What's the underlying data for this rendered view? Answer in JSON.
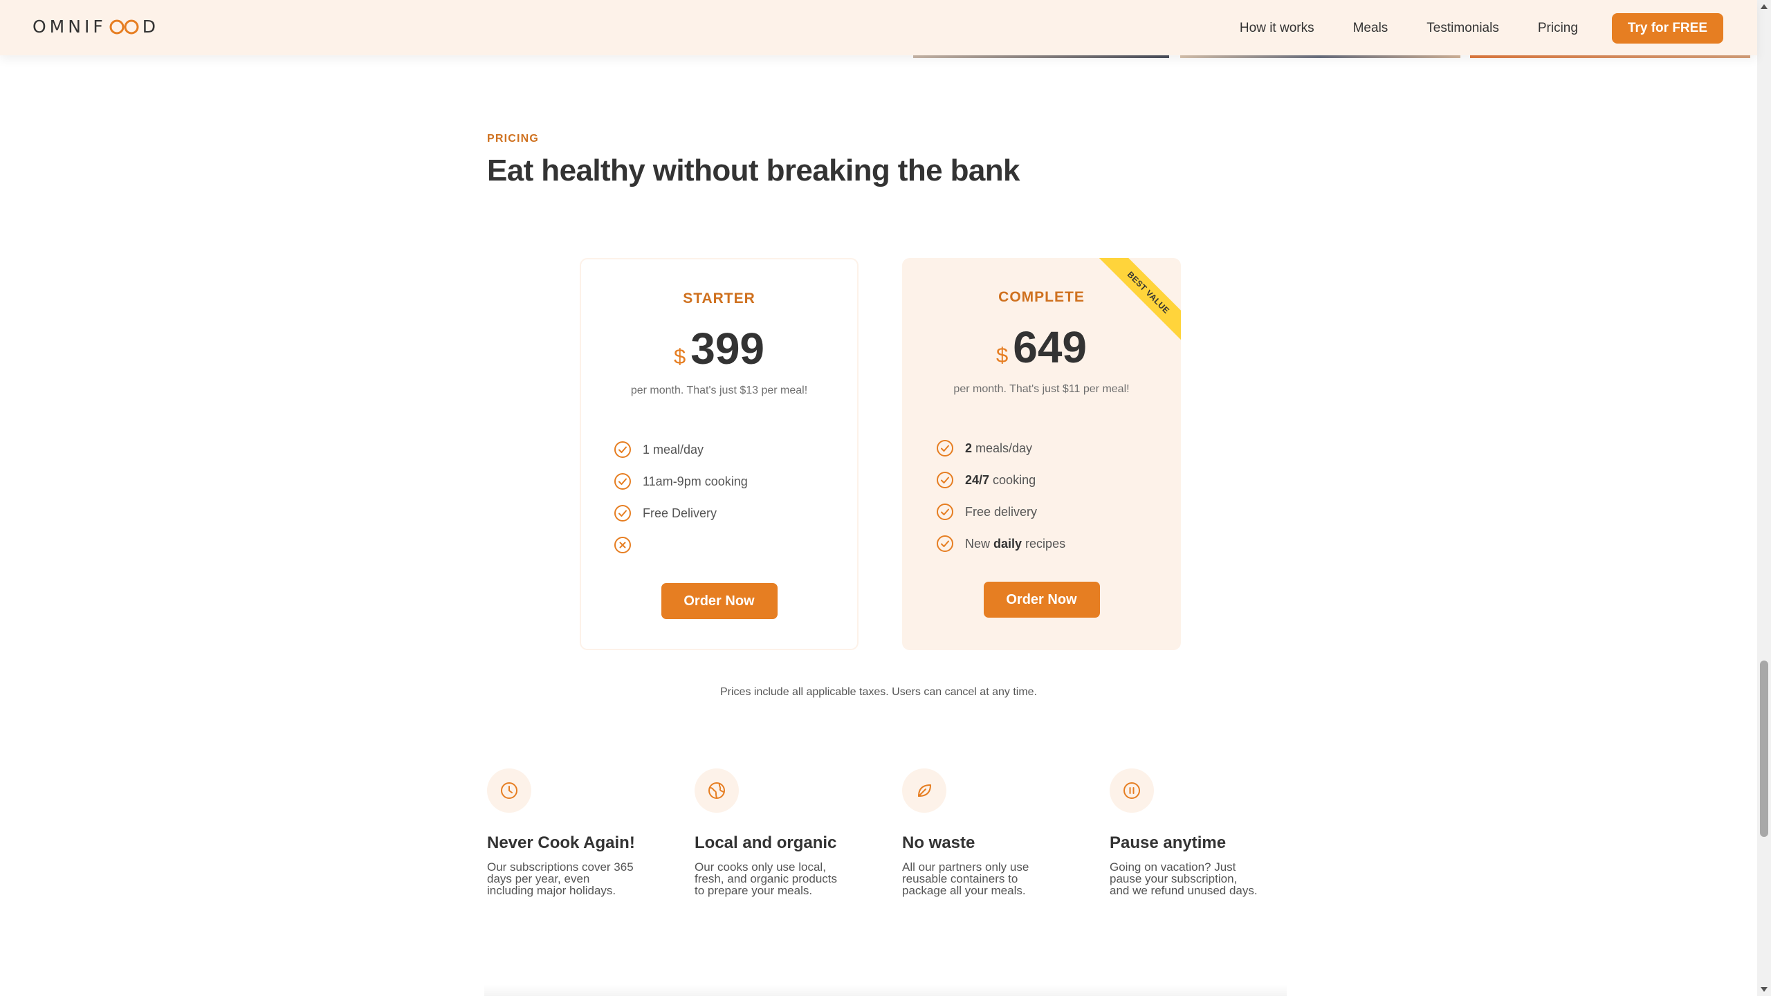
{
  "header": {
    "logo": {
      "prefix": "OMNIF",
      "suffix": "D"
    },
    "nav": [
      {
        "label": "How it works"
      },
      {
        "label": "Meals"
      },
      {
        "label": "Testimonials"
      },
      {
        "label": "Pricing"
      }
    ],
    "cta_label": "Try for FREE"
  },
  "pricing": {
    "subheading": "PRICING",
    "heading": "Eat healthy without breaking the bank",
    "plans": [
      {
        "name": "STARTER",
        "currency": "$",
        "price": "399",
        "note": "per month. That's just $13 per meal!",
        "features": [
          {
            "text": "1 meal/day",
            "icon": "check-circle-icon"
          },
          {
            "text": "11am-9pm cooking",
            "icon": "check-circle-icon"
          },
          {
            "text": "Free Delivery",
            "icon": "check-circle-icon"
          },
          {
            "text": "",
            "icon": "close-circle-icon"
          }
        ],
        "button": "Order Now"
      },
      {
        "name": "COMPLETE",
        "currency": "$",
        "price": "649",
        "note": "per month. That's just $11 per meal!",
        "ribbon": "BEST VALUE",
        "features": [
          {
            "bold": "2",
            "text": " meals/day",
            "icon": "check-circle-icon"
          },
          {
            "bold": "24/7",
            "text": " cooking",
            "icon": "check-circle-icon"
          },
          {
            "text": "Free delivery",
            "icon": "check-circle-icon"
          },
          {
            "pre": "New ",
            "bold": "daily",
            "text": " recipes",
            "icon": "check-circle-icon"
          }
        ],
        "button": "Order Now"
      }
    ],
    "details": "Prices include all applicable taxes. Users can cancel at any time."
  },
  "features": [
    {
      "icon": "clock-icon",
      "title": "Never Cook Again!",
      "lines": [
        "Our subscriptions cover 365",
        "days per year, even",
        "including major holidays."
      ]
    },
    {
      "icon": "globe-icon",
      "title": "Local and organic",
      "lines": [
        "Our cooks only use local,",
        "fresh, and organic products",
        "to prepare your meals."
      ]
    },
    {
      "icon": "leaf-icon",
      "title": "No waste",
      "lines": [
        "All our partners only use",
        "reusable containers to",
        "package all your meals."
      ]
    },
    {
      "icon": "pause-icon",
      "title": "Pause anytime",
      "lines": [
        "Going on vacation? Just",
        "pause your subscription,",
        "and we refund unused days."
      ]
    }
  ],
  "colors": {
    "accent": "#e67e22",
    "accent_dark": "#cf711f",
    "tint": "#fdf2e9",
    "ribbon": "#ffd43b",
    "text": "#333333"
  }
}
